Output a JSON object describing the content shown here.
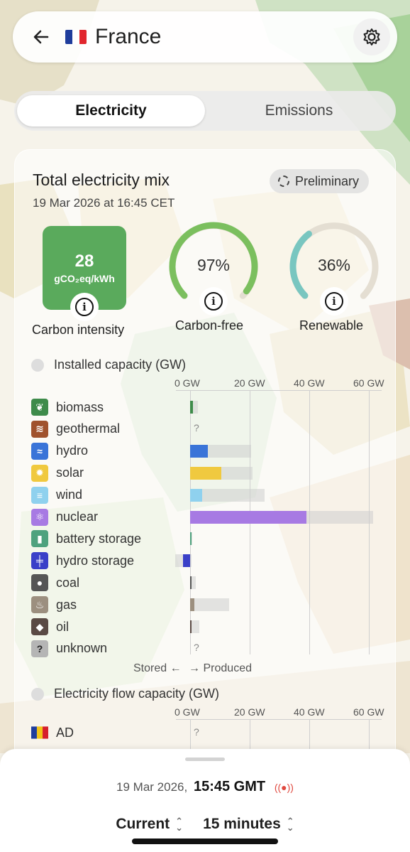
{
  "header": {
    "country": "France",
    "back_icon": "arrow-left-icon",
    "settings_icon": "gear-icon",
    "flag_colors": [
      "#1f3d9c",
      "#ffffff",
      "#e1262d"
    ]
  },
  "tabs": [
    {
      "label": "Electricity",
      "active": true
    },
    {
      "label": "Emissions",
      "active": false
    }
  ],
  "mix": {
    "title": "Total electricity mix",
    "date": "19 Mar 2026 at 16:45 CET",
    "badge": "Preliminary"
  },
  "metrics": {
    "carbon_intensity": {
      "value": "28",
      "unit": "gCO₂eq/kWh",
      "label": "Carbon intensity",
      "color": "#5aaa5c"
    },
    "carbon_free": {
      "value": "97%",
      "label": "Carbon-free",
      "fraction": 0.97,
      "color": "#7bbf5e"
    },
    "renewable": {
      "value": "36%",
      "label": "Renewable",
      "fraction": 0.36,
      "color": "#79c6c0"
    }
  },
  "installed": {
    "title": "Installed capacity (GW)",
    "ticks": [
      "0 GW",
      "20 GW",
      "40 GW",
      "60 GW"
    ],
    "stored_label": "Stored ←",
    "produced_label": "→ Produced",
    "rows": [
      {
        "label": "biomass",
        "icon": "leaf-icon",
        "color": "#3e8b4a",
        "produced": 1.0,
        "capacity": 2.5
      },
      {
        "label": "geothermal",
        "icon": "heat-waves-icon",
        "color": "#a0522d",
        "unknown": "?"
      },
      {
        "label": "hydro",
        "icon": "water-waves-icon",
        "color": "#3a74d8",
        "produced": 6.0,
        "capacity": 20.5
      },
      {
        "label": "solar",
        "icon": "sun-icon",
        "color": "#f0c93f",
        "produced": 10.5,
        "capacity": 21.0
      },
      {
        "label": "wind",
        "icon": "wind-icon",
        "color": "#8fd1ee",
        "produced": 4.0,
        "capacity": 25.0
      },
      {
        "label": "nuclear",
        "icon": "atom-icon",
        "color": "#a77ae3",
        "produced": 39.0,
        "capacity": 61.5
      },
      {
        "label": "battery storage",
        "icon": "battery-icon",
        "color": "#4ea27e",
        "produced": 0.5,
        "capacity": 0.8
      },
      {
        "label": "hydro storage",
        "icon": "dam-icon",
        "color": "#3a40c8",
        "stored": 2.5,
        "stored_capacity": 5.0,
        "capacity": 5.5
      },
      {
        "label": "coal",
        "icon": "coal-icon",
        "color": "#555555",
        "produced": 0.0,
        "capacity": 2.0
      },
      {
        "label": "gas",
        "icon": "flame-icon",
        "color": "#9c8f7f",
        "produced": 1.5,
        "capacity": 13.0
      },
      {
        "label": "oil",
        "icon": "oil-drop-icon",
        "color": "#5a4a44",
        "produced": 0.0,
        "capacity": 3.0
      },
      {
        "label": "unknown",
        "icon": "question-icon",
        "color": "#b5b5b5",
        "unknown": "?"
      }
    ]
  },
  "flow": {
    "title": "Electricity flow capacity (GW)",
    "ticks": [
      "0 GW",
      "20 GW",
      "40 GW",
      "60 GW"
    ],
    "rows": [
      {
        "label": "AD",
        "unknown": "?"
      }
    ]
  },
  "bottom": {
    "date": "19 Mar 2026,",
    "time": "15:45 GMT",
    "period": "Current",
    "granularity": "15 minutes"
  }
}
